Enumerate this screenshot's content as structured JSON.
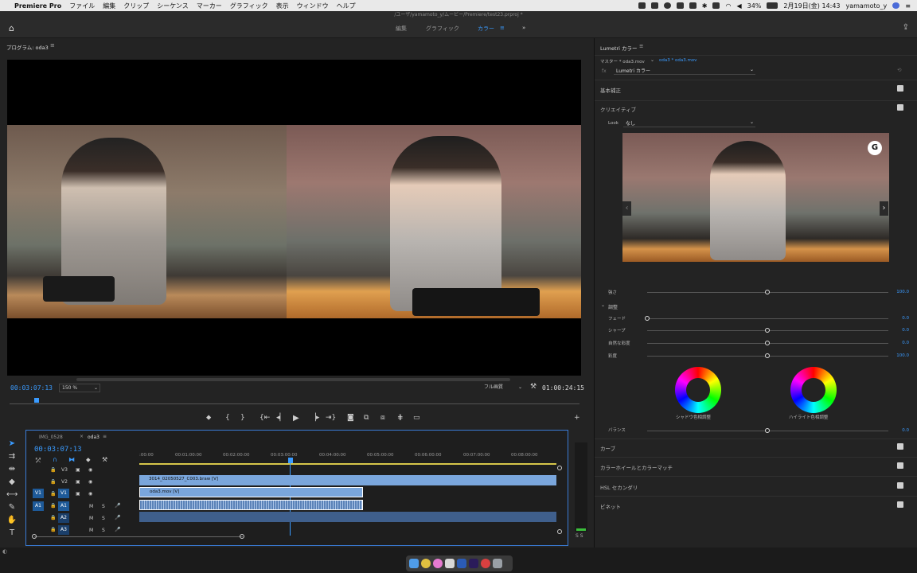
{
  "menubar": {
    "app": "Premiere Pro",
    "items": [
      "ファイル",
      "編集",
      "クリップ",
      "シーケンス",
      "マーカー",
      "グラフィック",
      "表示",
      "ウィンドウ",
      "ヘルプ"
    ],
    "battery": "34%",
    "datetime": "2月19日(金) 14:43",
    "user": "yamamoto_y"
  },
  "doc_path": "/ユーザ/yamamoto_y/ムービー/Premiere/test23.prproj *",
  "workspaces": {
    "edit": "編集",
    "graphics": "グラフィック",
    "color": "カラー"
  },
  "program": {
    "title": "プログラム: oda3",
    "timecode_left": "00:03:07:13",
    "zoom": "150 %",
    "quality": "フル画質",
    "timecode_right": "01:00:24:15"
  },
  "timeline": {
    "tabs": [
      "IMG_0528",
      "oda3"
    ],
    "timecode": "00:03:07:13",
    "ruler": [
      ":00:00",
      "00:01:00:00",
      "00:02:00:00",
      "00:03:00:00",
      "00:04:00:00",
      "00:05:00:00",
      "00:06:00:00",
      "00:07:00:00",
      "00:08:00:00"
    ],
    "tracks": {
      "v3": "V3",
      "v2": "V2",
      "v1": "V1",
      "a1": "A1",
      "a2": "A2",
      "a3": "A3",
      "patch_v1": "V1",
      "patch_a1": "A1",
      "m": "M",
      "s": "S"
    },
    "clips": {
      "v2": "3014_02050527_C003.braw [V]",
      "v1": "oda3.mov [V]"
    },
    "meter": "S  S"
  },
  "lumetri": {
    "title": "Lumetri カラー",
    "master": "マスター * oda3.mov",
    "seq": "oda3 * oda3.mov",
    "effect": "Lumetri カラー",
    "basic": "基本補正",
    "creative": "クリエイティブ",
    "look_label": "Look",
    "look_value": "なし",
    "intensity_label": "強さ",
    "intensity_val": "100.0",
    "adjust": "調整",
    "sliders": [
      {
        "label": "フェード",
        "value": "0.0",
        "pos": 0.0
      },
      {
        "label": "シャープ",
        "value": "0.0",
        "pos": 0.5
      },
      {
        "label": "自然な彩度",
        "value": "0.0",
        "pos": 0.5
      },
      {
        "label": "彩度",
        "value": "100.0",
        "pos": 0.5
      }
    ],
    "shadow_wheel": "シャドウ色相調整",
    "highlight_wheel": "ハイライト色相調整",
    "balance_label": "バランス",
    "balance_val": "0.0",
    "curves": "カーブ",
    "wheels_match": "カラーホイールとカラーマッチ",
    "hsl": "HSL セカンダリ",
    "vignette": "ビネット"
  },
  "colors": {
    "accent": "#3a9bff",
    "clip_video": "#7aa6dc",
    "clip_audio": "#5a82b8"
  }
}
